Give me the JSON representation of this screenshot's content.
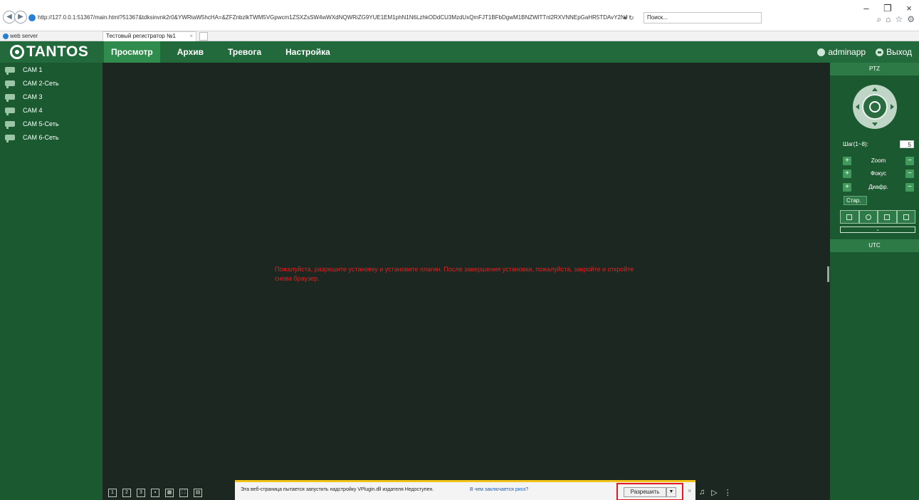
{
  "browser": {
    "url": "http://127.0.0.1:51367/main.html?51367&tdksinvnk2r0&YWRtaW5hcHA=&ZFZnbzlkTWM5VGpwcm1ZSXZsSW4wWXdNQWRiZG9YUE1EM1phN1N6LzhkODdCU3MzdUxQmFJT1BFbDgwM1BNZWlTTnl2RXVNNEpGaHR5TDAvY2NJ",
    "search_placeholder": "Поиск...",
    "favorite": "web server",
    "tab_title": "Тестовый регистратор №1",
    "tab_close": "×"
  },
  "app": {
    "logo": "TANTOS",
    "nav": [
      "Просмотр",
      "Архив",
      "Тревога",
      "Настройка"
    ],
    "user": "adminapp",
    "logout": "Выход"
  },
  "cameras": [
    "CAM 1",
    "CAM 2-Сеть",
    "CAM 3",
    "CAM 4",
    "CAM 5-Сеть",
    "CAM 6-Сеть"
  ],
  "video": {
    "message": "Пожалуйста, разрешите установку и установите плагин. После завершения установки, пожалуйста, закройте и откройте снова браузер."
  },
  "ptz": {
    "title": "PTZ",
    "step_label": "Шаг(1~8):",
    "step_value": "5",
    "zoom": "Zoom",
    "focus": "Фокус",
    "iris": "Диафр.",
    "start": "Стар.",
    "utc": "UTC"
  },
  "notification": {
    "text": "Эта веб-страница пытается запустить надстройку VPlugin.dll издателя Недоступен.",
    "link": "В чем заключается риск?",
    "allow": "Разрешить"
  },
  "colors": {
    "header": "#226a3b",
    "sidebar": "#1b5a30",
    "video_bg": "#1b2720",
    "message": "#e32020",
    "highlight": "#e01b24"
  }
}
